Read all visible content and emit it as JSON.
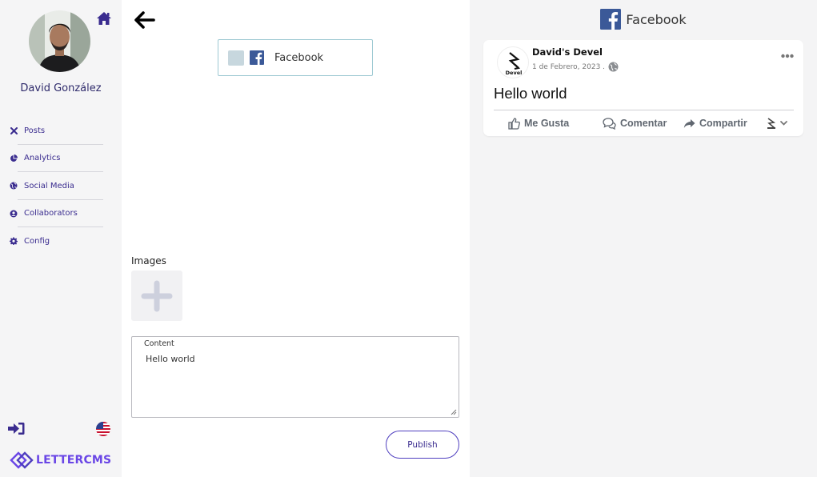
{
  "sidebar": {
    "user_name": "David González",
    "nav": [
      {
        "label": "Posts",
        "icon": "close-icon"
      },
      {
        "label": "Analytics",
        "icon": "pie-chart-icon"
      },
      {
        "label": "Social Media",
        "icon": "globe-icon"
      },
      {
        "label": "Collaborators",
        "icon": "user-circle-icon"
      },
      {
        "label": "Config",
        "icon": "gear-icon"
      }
    ],
    "brand": "LETTERCMS",
    "icons": {
      "home": "home-icon",
      "logout": "logout-icon",
      "language": "us-flag-icon"
    }
  },
  "editor": {
    "network_option": "Facebook",
    "images_label": "Images",
    "content_label": "Content",
    "content_value": "Hello world",
    "publish_label": "Publish"
  },
  "preview": {
    "title": "Facebook",
    "page_name": "David's Devel",
    "date": "1 de Febrero, 2023 .",
    "post_text": "Hello world",
    "actions": {
      "like": "Me Gusta",
      "comment": "Comentar",
      "share": "Compartir"
    }
  },
  "colors": {
    "accent": "#3a2c8f",
    "brand_purple": "#6a46e6",
    "facebook_blue": "#1877f2",
    "sidebar_bg": "#f5f5f6",
    "preview_bg": "#f4f4f5"
  }
}
